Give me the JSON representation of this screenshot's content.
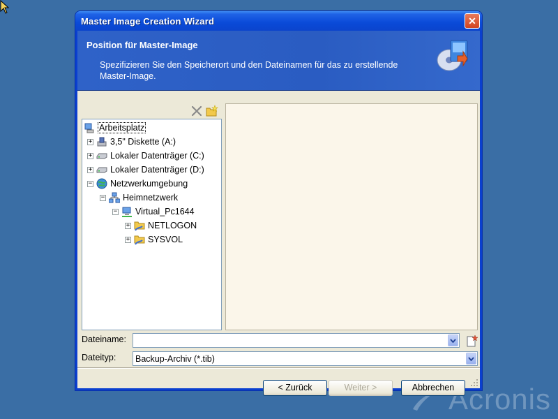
{
  "window": {
    "title": "Master Image Creation Wizard",
    "close_glyph": "✕"
  },
  "header": {
    "title": "Position für Master-Image",
    "description": "Spezifizieren Sie den Speicherort und den Dateinamen für das zu erstellende Master-Image."
  },
  "toolbar": {
    "delete_icon": "delete-icon",
    "new_folder_icon": "new-folder-icon"
  },
  "tree": {
    "items": [
      {
        "label": "Arbeitsplatz",
        "icon": "my-computer-icon",
        "expander": "",
        "selected": true
      },
      {
        "label": "3,5\" Diskette (A:)",
        "icon": "floppy-drive-icon",
        "expander": "+"
      },
      {
        "label": "Lokaler Datenträger (C:)",
        "icon": "hard-drive-icon",
        "expander": "+"
      },
      {
        "label": "Lokaler Datenträger (D:)",
        "icon": "hard-drive-icon",
        "expander": "+"
      },
      {
        "label": "Netzwerkumgebung",
        "icon": "network-places-icon",
        "expander": "−"
      },
      {
        "label": "Heimnetzwerk",
        "icon": "network-icon",
        "expander": "−"
      },
      {
        "label": "Virtual_Pc1644",
        "icon": "computer-icon",
        "expander": "−"
      },
      {
        "label": "NETLOGON",
        "icon": "shared-folder-icon",
        "expander": "+"
      },
      {
        "label": "SYSVOL",
        "icon": "shared-folder-icon",
        "expander": "+"
      }
    ]
  },
  "form": {
    "filename_label": "Dateiname:",
    "filename_value": "",
    "filetype_label": "Dateityp:",
    "filetype_value": "Backup-Archiv (*.tib)"
  },
  "buttons": {
    "back": "< Zurück",
    "next": "Weiter >",
    "cancel": "Abbrechen"
  },
  "watermark": "Acronis",
  "colors": {
    "desktop": "#3a6ea5",
    "title_blue": "#0a4ad8",
    "header_blue": "#2f62c8",
    "dialog_bg": "#ece9d8",
    "content_bg": "#fbf6ea"
  }
}
